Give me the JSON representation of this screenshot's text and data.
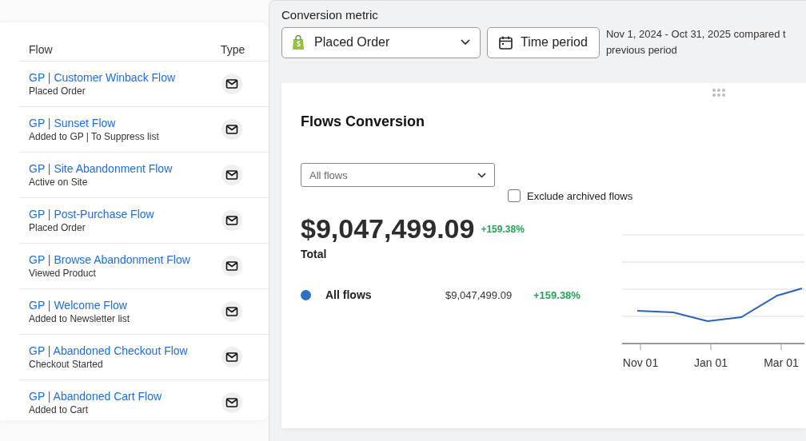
{
  "flows_table": {
    "columns": [
      "Flow",
      "Type"
    ],
    "rows": [
      {
        "name": "GP | Customer Winback Flow",
        "trigger": "Placed Order"
      },
      {
        "name": "GP | Sunset Flow",
        "trigger": "Added to GP | To Suppress list"
      },
      {
        "name": "GP | Site Abandonment Flow",
        "trigger": "Active on Site"
      },
      {
        "name": "GP | Post-Purchase Flow",
        "trigger": "Placed Order"
      },
      {
        "name": "GP | Browse Abandonment Flow",
        "trigger": "Viewed Product"
      },
      {
        "name": "GP | Welcome Flow",
        "trigger": "Added to Newsletter list"
      },
      {
        "name": "GP | Abandoned Checkout Flow",
        "trigger": "Checkout Started"
      },
      {
        "name": "GP | Abandoned Cart Flow",
        "trigger": "Added to Cart"
      }
    ]
  },
  "report": {
    "metric_label": "Conversion metric",
    "metric_value": "Placed Order",
    "time_button": "Time period",
    "date_range": "Nov 1, 2024 - Oct 31, 2025 compared t",
    "date_range_line_2": "previous period",
    "card": {
      "title": "Flows Conversion",
      "flow_select": "All flows",
      "exclude_archived": {
        "label": "Exclude archived flows",
        "checked": false
      },
      "total_value": "$9,047,499.09",
      "total_change": "+159.38%",
      "total_label": "Total",
      "legend": [
        {
          "name": "All flows",
          "color": "#2f6fc4",
          "value": "$9,047,499.09",
          "change": "+159.38%"
        }
      ],
      "x_labels": [
        "Nov 01",
        "Jan 01",
        "Mar 01"
      ]
    }
  }
}
